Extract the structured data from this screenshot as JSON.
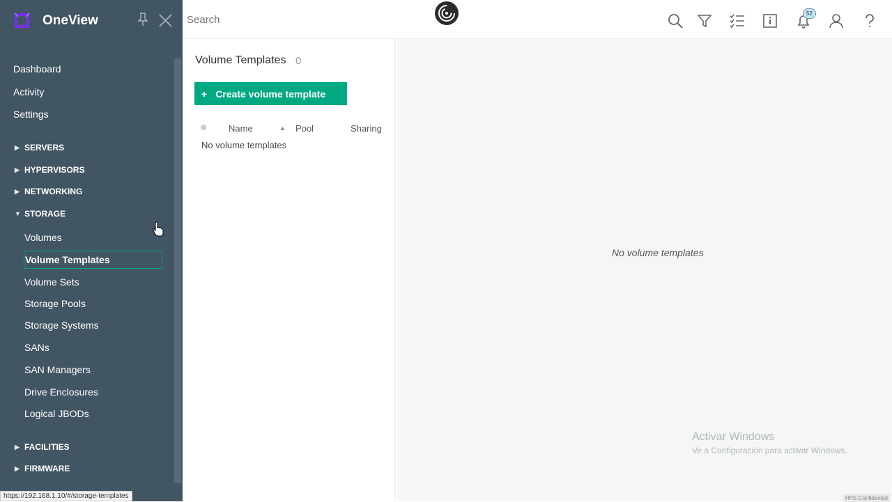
{
  "app": {
    "name": "OneView"
  },
  "sidebar": {
    "top_items": [
      "Dashboard",
      "Activity",
      "Settings"
    ],
    "categories": [
      {
        "label": "SERVERS",
        "expanded": false
      },
      {
        "label": "HYPERVISORS",
        "expanded": false
      },
      {
        "label": "NETWORKING",
        "expanded": false
      },
      {
        "label": "STORAGE",
        "expanded": true
      }
    ],
    "storage_items": [
      "Volumes",
      "Volume Templates",
      "Volume Sets",
      "Storage Pools",
      "Storage Systems",
      "SANs",
      "SAN Managers",
      "Drive Enclosures",
      "Logical JBODs"
    ],
    "active_item": "Volume Templates",
    "categories_after": [
      {
        "label": "FACILITIES"
      },
      {
        "label": "FIRMWARE"
      }
    ]
  },
  "topbar": {
    "search_placeholder": "Search",
    "notification_count": "52",
    "icons": [
      "search-icon",
      "filter-icon",
      "checklist-icon",
      "info-icon",
      "bell-icon",
      "user-icon",
      "help-icon"
    ]
  },
  "list_panel": {
    "title": "Volume Templates",
    "count": "0",
    "create_label": "Create volume template",
    "columns": [
      "Name",
      "Pool",
      "Sharing"
    ],
    "empty_text": "No volume templates"
  },
  "detail": {
    "empty_text": "No volume templates"
  },
  "watermark": {
    "line1": "Activar Windows",
    "line2": "Ve a Configuración para activar Windows."
  },
  "footer": {
    "status_url": "https://192.168.1.10/#/storage-templates",
    "classification": "HPE Confidential"
  },
  "colors": {
    "sidebar": "#425563",
    "accent": "#01a982"
  }
}
